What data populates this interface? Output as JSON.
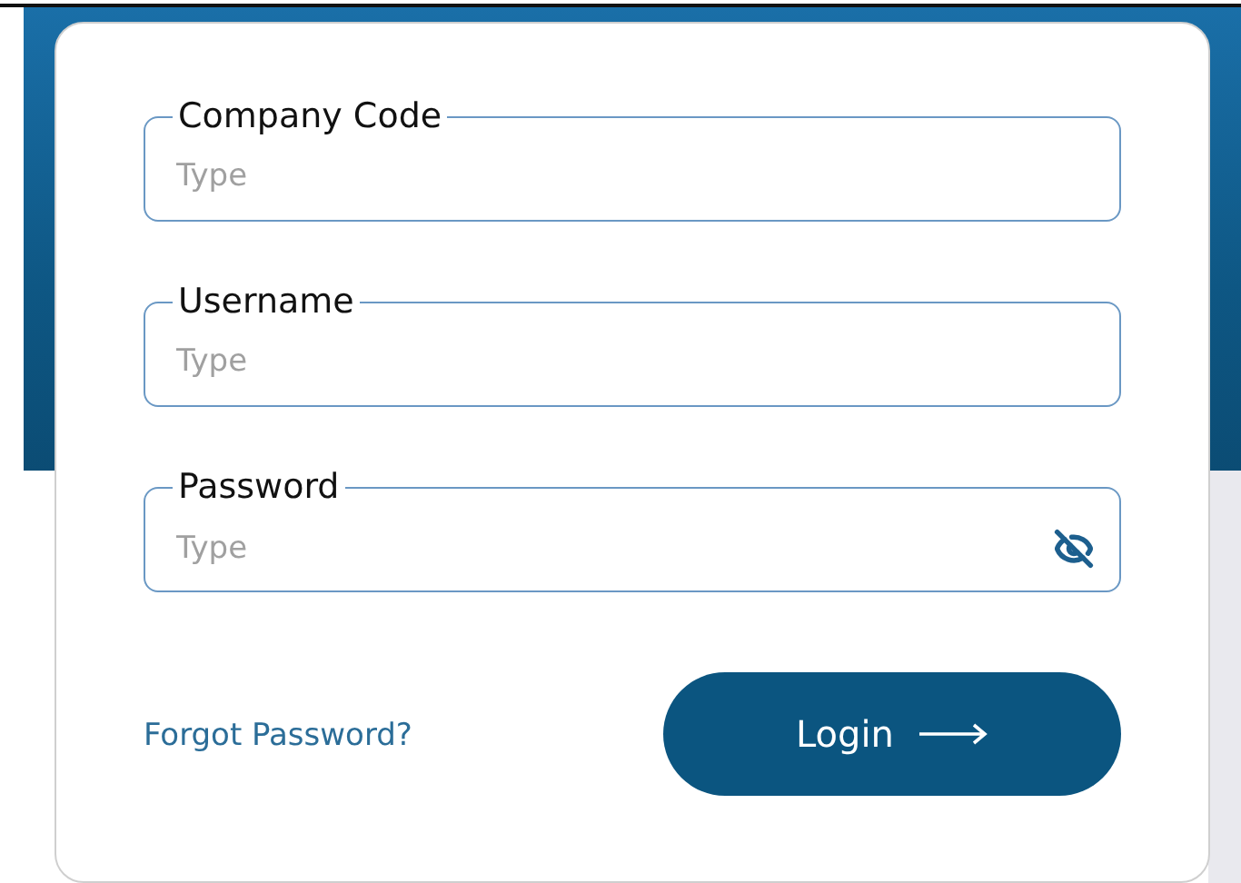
{
  "fields": [
    {
      "label": "Company Code",
      "placeholder": "Type",
      "kind": "text"
    },
    {
      "label": "Username",
      "placeholder": "Type",
      "kind": "text"
    },
    {
      "label": "Password",
      "placeholder": "Type",
      "kind": "password"
    }
  ],
  "forgot_link": "Forgot Password?",
  "login_button": "Login"
}
